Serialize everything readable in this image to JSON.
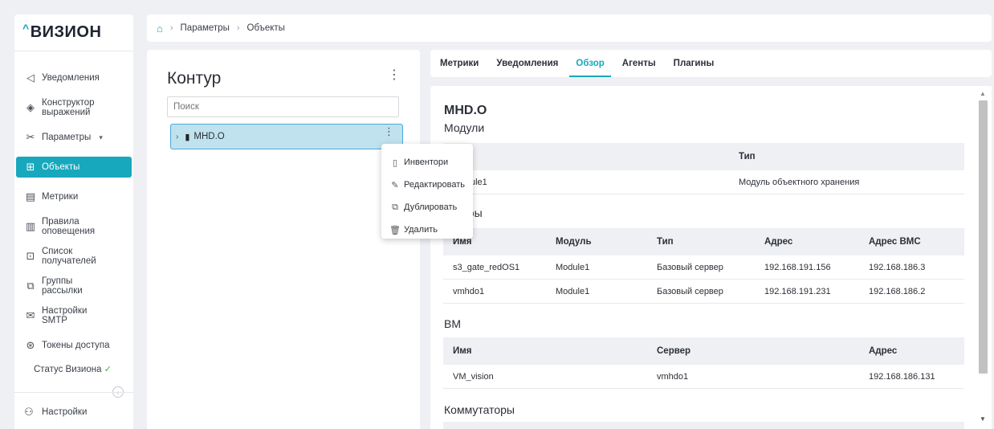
{
  "brand": {
    "caret": "^",
    "name": "ВИЗИОН"
  },
  "colors": {
    "accent": "#17a8bd",
    "selection_bg": "#bfe2ee",
    "selection_border": "#4aa8dd",
    "ok": "#3db84a"
  },
  "sidebar": {
    "items": [
      {
        "label": "Уведомления",
        "icon": "send-icon",
        "glyph": "◁"
      },
      {
        "label": "Конструктор\nвыражений",
        "icon": "diamond-nodes-icon",
        "glyph": "◈"
      },
      {
        "label": "Параметры",
        "icon": "tools-icon",
        "glyph": "✂",
        "chevron": "▾"
      },
      {
        "label": "Объекты",
        "icon": "hierarchy-icon",
        "glyph": "⊞",
        "active": true
      },
      {
        "label": "Метрики",
        "icon": "metrics-icon",
        "glyph": "▤"
      },
      {
        "label": "Правила\nоповещения",
        "icon": "rules-icon",
        "glyph": "▥"
      },
      {
        "label": "Список\nполучателей",
        "icon": "recipients-icon",
        "glyph": "⊡"
      },
      {
        "label": "Группы\nрассылки",
        "icon": "groups-icon",
        "glyph": "⧉"
      },
      {
        "label": "Настройки\nSMTP",
        "icon": "smtp-icon",
        "glyph": "✉"
      },
      {
        "label": "Токены доступа",
        "icon": "token-icon",
        "glyph": "⊛"
      }
    ],
    "status": {
      "label": "Статус Визиона",
      "check": "✓"
    },
    "collapse": "‹",
    "settings": {
      "label": "Настройки",
      "glyph": "⚇"
    }
  },
  "breadcrumb": {
    "home": "⌂",
    "sep": "›",
    "items": [
      "Параметры",
      "Объекты"
    ]
  },
  "tree": {
    "title": "Контур",
    "kebab": "⋮",
    "search_placeholder": "Поиск",
    "node": {
      "label": "MHD.O",
      "arrow": "›",
      "glyph": "▮",
      "kebab": "⋮"
    }
  },
  "context_menu": [
    {
      "label": "Инвентори",
      "glyph": "▯",
      "icon": "document-icon"
    },
    {
      "label": "Редактировать",
      "glyph": "✎",
      "icon": "pencil-icon"
    },
    {
      "label": "Дублировать",
      "glyph": "⧉",
      "icon": "duplicate-icon"
    },
    {
      "label": "Удалить",
      "glyph": "🗑",
      "icon": "trash-icon"
    }
  ],
  "tabs": [
    {
      "label": "Метрики"
    },
    {
      "label": "Уведомления"
    },
    {
      "label": "Обзор",
      "active": true
    },
    {
      "label": "Агенты"
    },
    {
      "label": "Плагины"
    }
  ],
  "content": {
    "title": "MHD.O",
    "modules": {
      "title": "Модули",
      "columns": [
        "",
        "Тип"
      ],
      "rows": [
        [
          "ule1",
          "Модуль объектного хранения"
        ]
      ]
    },
    "servers": {
      "title": "еры",
      "columns": [
        "Имя",
        "Модуль",
        "Тип",
        "Адрес",
        "Адрес BMC"
      ],
      "rows": [
        [
          "s3_gate_redOS1",
          "Module1",
          "Базовый сервер",
          "192.168.191.156",
          "192.168.186.3"
        ],
        [
          "vmhdo1",
          "Module1",
          "Базовый сервер",
          "192.168.191.231",
          "192.168.186.2"
        ]
      ]
    },
    "vms": {
      "title": "ВМ",
      "columns": [
        "Имя",
        "Сервер",
        "Адрес"
      ],
      "rows": [
        [
          "VM_vision",
          "vmhdo1",
          "192.168.186.131"
        ]
      ]
    },
    "switches": {
      "title": "Коммутаторы"
    }
  },
  "scrollbar": {
    "up": "▲",
    "down": "▼"
  }
}
